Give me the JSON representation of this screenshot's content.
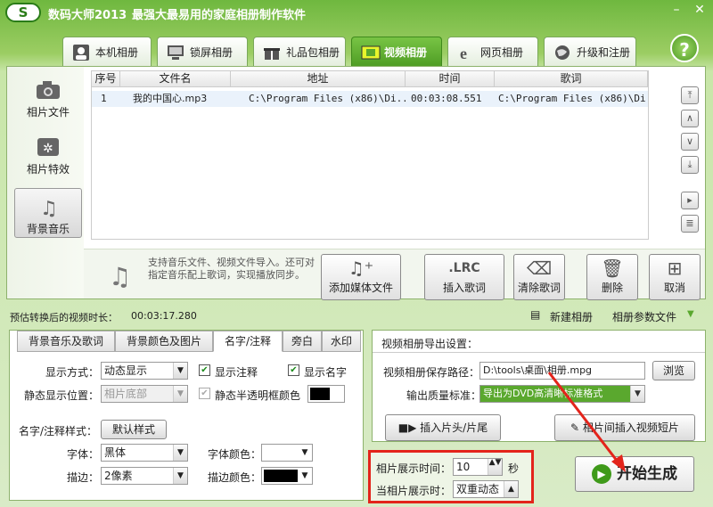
{
  "app": {
    "logo": "S",
    "title": "数码大师2013",
    "subtitle": "最强大最易用的家庭相册制作软件"
  },
  "tabs": [
    {
      "label": "本机相册",
      "icon": "person-frame-icon"
    },
    {
      "label": "锁屏相册",
      "icon": "monitor-icon"
    },
    {
      "label": "礼品包相册",
      "icon": "gift-icon"
    },
    {
      "label": "视频相册",
      "icon": "film-icon",
      "active": true
    },
    {
      "label": "网页相册",
      "icon": "ie-icon"
    },
    {
      "label": "升级和注册",
      "icon": "globe-icon"
    }
  ],
  "help": "?",
  "leftnav": [
    {
      "label": "相片文件",
      "icon": "camera-icon"
    },
    {
      "label": "相片特效",
      "icon": "effects-icon"
    },
    {
      "label": "背景音乐",
      "icon": "music-note-icon",
      "active": true
    }
  ],
  "table": {
    "headers": [
      "序号",
      "文件名",
      "地址",
      "时间",
      "歌词"
    ],
    "rows": [
      [
        "1",
        "我的中国心.mp3",
        "C:\\Program Files (x86)\\Di...",
        "00:03:08.551",
        "C:\\Program Files (x86)\\Di..."
      ]
    ]
  },
  "hint": "支持音乐文件、视频文件导入。还可对指定音乐配上歌词，实现播放同步。",
  "actions": {
    "add_media": "添加媒体文件",
    "insert_lyrics": "插入歌词",
    "clear_lyrics": "清除歌词",
    "delete": "删除",
    "cancel": "取消",
    "lrc": ".LRC"
  },
  "infobar": {
    "estimate_label": "预估转换后的视频时长：",
    "estimate_value": "00:03:17.280",
    "new_album": "新建相册",
    "album_params": "相册参数文件"
  },
  "lefttabs": [
    "背景音乐及歌词",
    "背景颜色及图片",
    "名字/注释",
    "旁白",
    "水印"
  ],
  "captions": {
    "display_mode_label": "显示方式：",
    "display_mode_value": "动态显示",
    "show_note": "显示注释",
    "show_name": "显示名字",
    "static_pos_label": "静态显示位置：",
    "static_pos_value": "相片底部",
    "semi_frame": "静态半透明框颜色",
    "style_label": "名字/注释样式：",
    "default_style": "默认样式",
    "font_label": "字体：",
    "font_value": "黑体",
    "font_color_label": "字体颜色：",
    "stroke_label": "描边：",
    "stroke_value": "2像素",
    "stroke_color_label": "描边颜色："
  },
  "export": {
    "heading": "视频相册导出设置：",
    "path_label": "视频相册保存路径：",
    "path_value": "D:\\tools\\桌面\\相册.mpg",
    "browse": "浏览",
    "quality_label": "输出质量标准：",
    "quality_value": "导出为DVD高清晰标准格式",
    "insert_header": "插入片头/片尾",
    "insert_clip": "相片间插入视频短片"
  },
  "timing": {
    "duration_label": "相片展示时间：",
    "duration_value": "10",
    "unit": "秒",
    "effect_label": "当相片展示时：",
    "effect_value": "双重动态"
  },
  "start": "开始生成",
  "colors": {
    "accent": "#5aa82e",
    "highlight": "#e3241b"
  }
}
